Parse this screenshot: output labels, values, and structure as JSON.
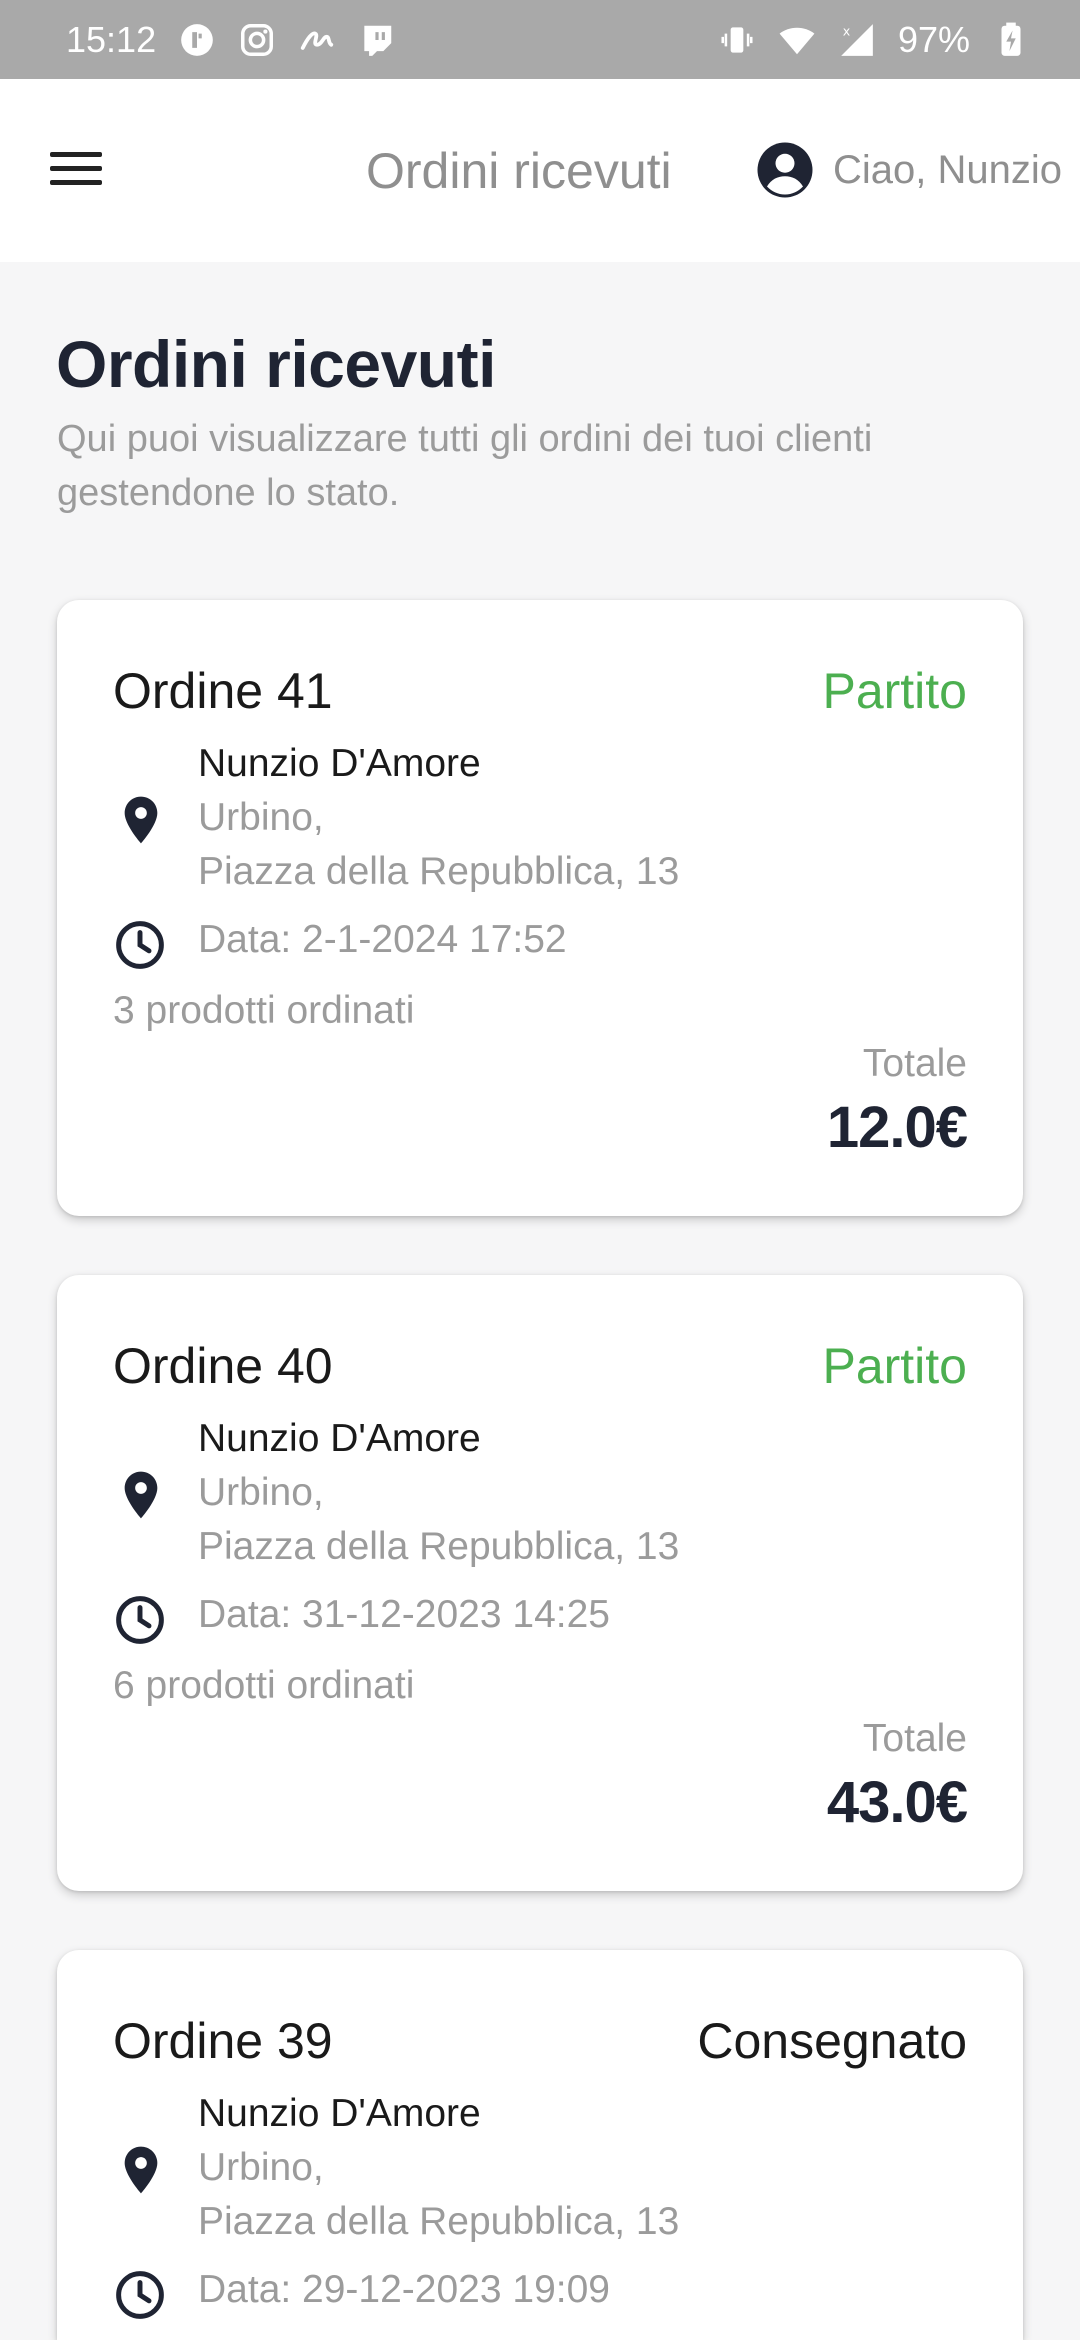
{
  "status_bar": {
    "time": "15:12",
    "battery_percent": "97%",
    "icons_left": [
      "mask-app-icon",
      "instagram-icon",
      "signature-icon",
      "twitch-icon"
    ],
    "icons_right": [
      "vibrate-icon",
      "wifi-icon",
      "signal-icon",
      "battery-charging-icon"
    ]
  },
  "app_bar": {
    "menu_icon": "hamburger-menu-icon",
    "title": "Ordini ricevuti",
    "user_greeting": "Ciao, Nunzio",
    "user_icon": "account-circle-icon"
  },
  "page": {
    "title": "Ordini ricevuti",
    "subtitle": "Qui puoi visualizzare tutti gli ordini dei tuoi clienti gestendone lo stato."
  },
  "orders": [
    {
      "title": "Ordine 41",
      "status": "Partito",
      "status_color": "#4caf50",
      "customer": "Nunzio D'Amore",
      "address_line1": "Urbino,",
      "address_line2": "Piazza della Repubblica, 13",
      "date": "Data: 2-1-2024 17:52",
      "items": "3 prodotti ordinati",
      "total_label": "Totale",
      "total": "12.0€"
    },
    {
      "title": "Ordine 40",
      "status": "Partito",
      "status_color": "#4caf50",
      "customer": "Nunzio D'Amore",
      "address_line1": "Urbino,",
      "address_line2": "Piazza della Repubblica, 13",
      "date": "Data: 31-12-2023 14:25",
      "items": "6 prodotti ordinati",
      "total_label": "Totale",
      "total": "43.0€"
    },
    {
      "title": "Ordine 39",
      "status": "Consegnato",
      "status_color": "#1a1a1a",
      "customer": "Nunzio D'Amore",
      "address_line1": "Urbino,",
      "address_line2": "Piazza della Repubblica, 13",
      "date": "Data: 29-12-2023 19:09"
    }
  ]
}
